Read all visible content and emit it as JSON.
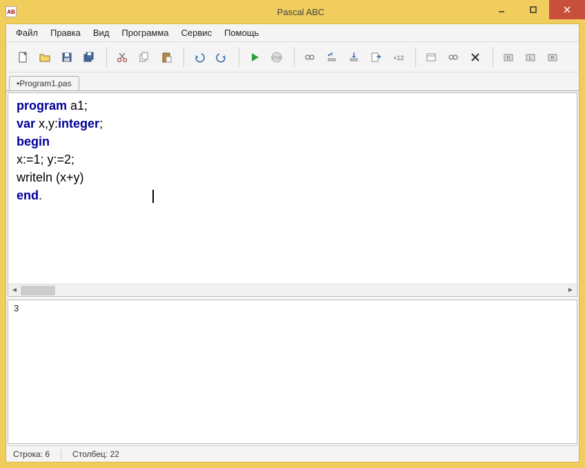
{
  "window": {
    "title": "Pascal ABC"
  },
  "menu": [
    "Файл",
    "Правка",
    "Вид",
    "Программа",
    "Сервис",
    "Помощь"
  ],
  "toolbar": {
    "items": [
      "new",
      "open",
      "save",
      "saveall",
      "cut",
      "copy",
      "paste",
      "undo",
      "redo",
      "run",
      "stop",
      "watch",
      "stepover",
      "stepinto",
      "goto",
      "vars",
      "panel1",
      "panel2",
      "delete",
      "debug1",
      "debug2",
      "debug3"
    ]
  },
  "tab": {
    "label": "•Program1.pas"
  },
  "code": {
    "l1": {
      "kw": "program",
      "id": " a1;"
    },
    "l2": {
      "kw": "var",
      "id": " x,y:",
      "ty": "integer",
      "sc": ";"
    },
    "l3": {
      "kw": "begin"
    },
    "l4": "x:=1; y:=2;",
    "l5": "writeln (x+y)",
    "l6": {
      "kw": "end",
      "sc": "."
    }
  },
  "output": "3",
  "status": {
    "line": "Строка: 6",
    "col": "Столбец: 22"
  }
}
